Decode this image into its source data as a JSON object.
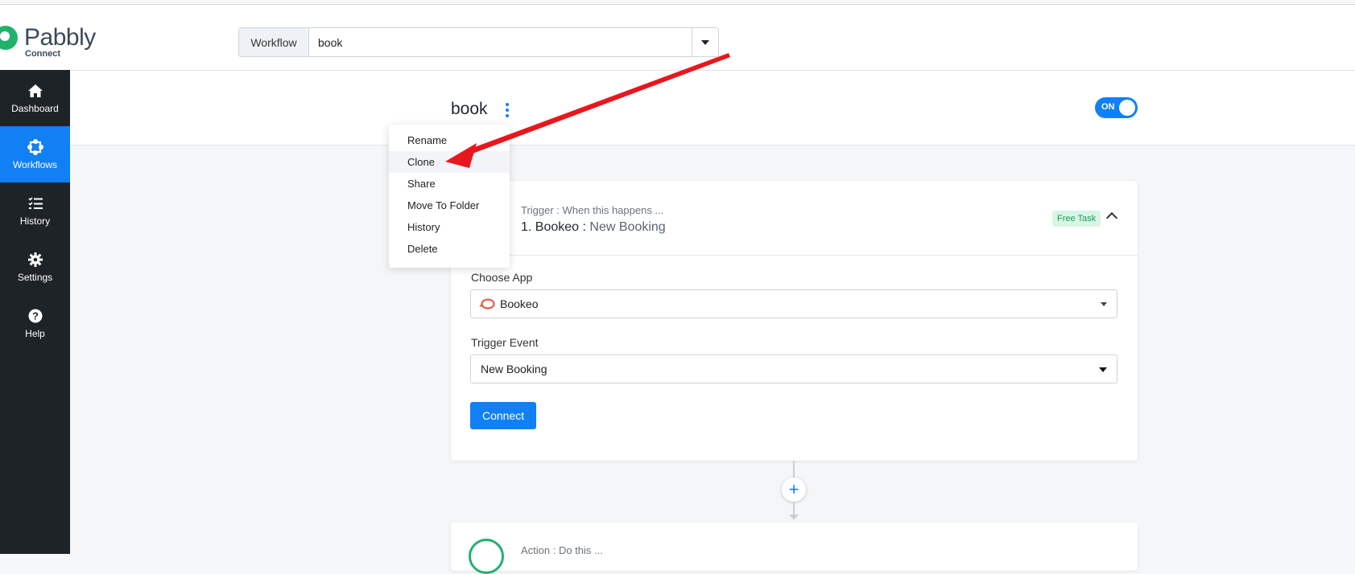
{
  "app": {
    "logo_text": "Pabbly",
    "logo_sub": "Connect"
  },
  "header": {
    "workflow_label": "Workflow",
    "workflow_value": "book"
  },
  "sidebar": {
    "items": [
      {
        "label": "Dashboard",
        "icon": "home-icon"
      },
      {
        "label": "Workflows",
        "icon": "workflow-icon",
        "active": true
      },
      {
        "label": "History",
        "icon": "list-icon"
      },
      {
        "label": "Settings",
        "icon": "gear-icon"
      },
      {
        "label": "Help",
        "icon": "help-icon"
      }
    ]
  },
  "workflow": {
    "title": "book",
    "toggle_label": "ON"
  },
  "menu": {
    "items": [
      "Rename",
      "Clone",
      "Share",
      "Move To Folder",
      "History",
      "Delete"
    ],
    "highlighted": "Clone"
  },
  "trigger": {
    "subtitle": "Trigger : When this happens ...",
    "step": "1. Bookeo :",
    "event": "New Booking",
    "badge": "Free Task",
    "choose_app_label": "Choose App",
    "app_value": "Bookeo",
    "trigger_event_label": "Trigger Event",
    "trigger_event_value": "New Booking",
    "connect_label": "Connect"
  },
  "connector": {
    "plus": "+"
  },
  "action": {
    "subtitle": "Action : Do this ..."
  },
  "colors": {
    "primary": "#1180f4",
    "sidebar_bg": "#1e2327",
    "brand_green": "#20b26b",
    "badge_bg": "#d8f5e6",
    "badge_text": "#1a9c5b",
    "annotation_red": "#e8171d",
    "bookeo_icon": "#e5533d"
  }
}
